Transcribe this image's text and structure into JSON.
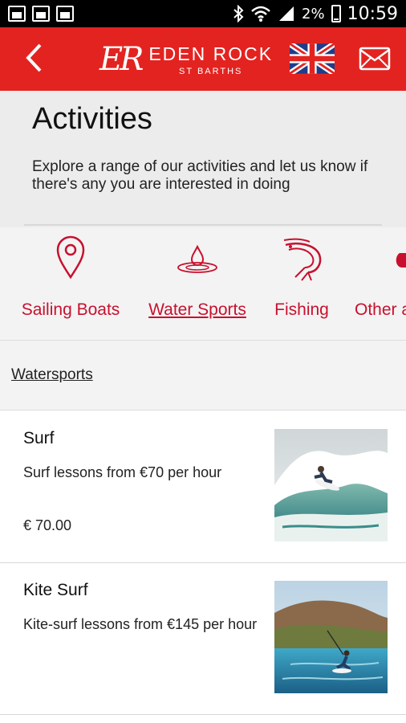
{
  "status_bar": {
    "battery_percent": "2%",
    "time": "10:59"
  },
  "app_bar": {
    "logo_mark": "ER",
    "logo_title": "EDEN ROCK",
    "logo_subtitle": "ST BARTHS",
    "back_icon": "chevron-left-icon",
    "flag_icon": "uk-flag-icon",
    "mail_icon": "envelope-icon"
  },
  "header": {
    "title": "Activities",
    "description": "Explore a range of our activities and let us know if there's any you are interested in doing"
  },
  "categories": [
    {
      "label": "Sailing Boats",
      "icon": "map-pin-icon",
      "active": false
    },
    {
      "label": "Water Sports",
      "icon": "water-drop-icon",
      "active": true
    },
    {
      "label": "Fishing",
      "icon": "shrimp-icon",
      "active": false
    },
    {
      "label": "Other a",
      "icon": "other-icon",
      "active": false
    }
  ],
  "section": {
    "title": "Watersports"
  },
  "items": [
    {
      "name": "Surf",
      "description": "Surf lessons from €70 per hour",
      "price": "€ 70.00",
      "image": "surf-photo"
    },
    {
      "name": "Kite Surf",
      "description": "Kite-surf lessons from €145 per hour",
      "price": "",
      "image": "kitesurf-photo"
    }
  ],
  "colors": {
    "brand_red": "#e32320",
    "accent_red": "#c8102e"
  }
}
